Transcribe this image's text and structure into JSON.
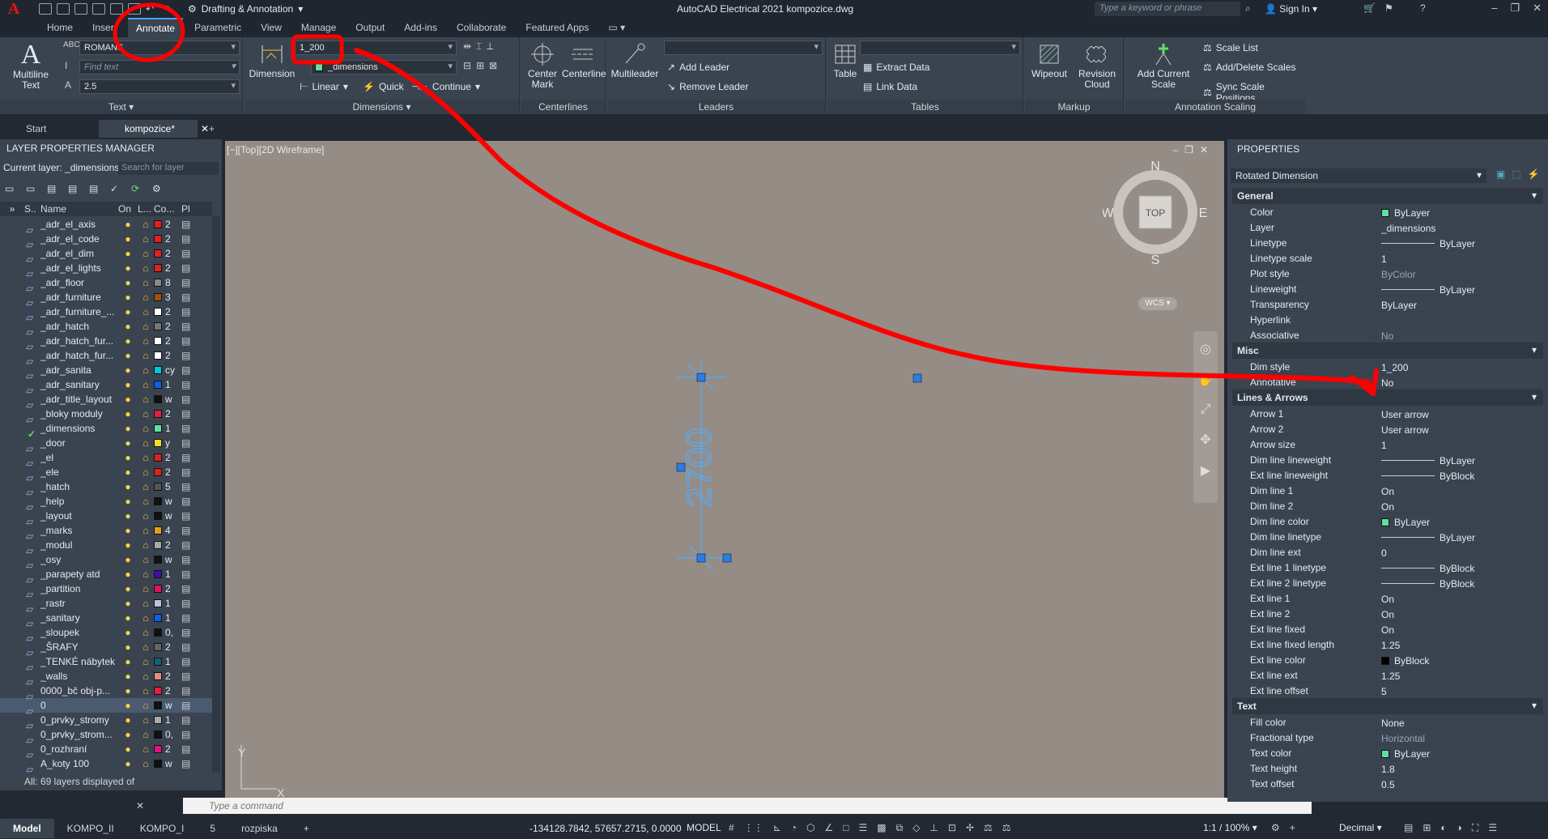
{
  "titlebar": {
    "workspace": "Drafting & Annotation",
    "app_title": "AutoCAD Electrical 2021   kompozice.dwg",
    "search_placeholder": "Type a keyword or phrase",
    "signin": "Sign In"
  },
  "ribbon_tabs": [
    "Home",
    "Insert",
    "Annotate",
    "Parametric",
    "View",
    "Manage",
    "Output",
    "Add-ins",
    "Collaborate",
    "Featured Apps"
  ],
  "ribbon": {
    "text_panel": {
      "title": "Text",
      "multiline": "Multiline Text",
      "font": "ROMANS",
      "find_placeholder": "Find text",
      "height": "2.5"
    },
    "dim_panel": {
      "title": "Dimensions",
      "dimension": "Dimension",
      "style": "1_200",
      "layer": "_dimensions",
      "linear": "Linear",
      "quick": "Quick",
      "continue": "Continue"
    },
    "centerlines": {
      "title": "Centerlines",
      "center_mark": "Center Mark",
      "centerline": "Centerline"
    },
    "leaders": {
      "title": "Leaders",
      "multileader": "Multileader",
      "add_leader": "Add Leader",
      "remove_leader": "Remove Leader"
    },
    "tables": {
      "title": "Tables",
      "table": "Table",
      "extract": "Extract Data",
      "link": "Link Data"
    },
    "markup": {
      "title": "Markup",
      "wipeout": "Wipeout",
      "revision": "Revision Cloud"
    },
    "scaling": {
      "title": "Annotation Scaling",
      "add_scale": "Add Current Scale",
      "scale_list": "Scale List",
      "add_delete": "Add/Delete Scales",
      "sync": "Sync Scale Positions"
    }
  },
  "doc_tabs": [
    "Start",
    "kompozice*"
  ],
  "layer_manager": {
    "title": "LAYER PROPERTIES MANAGER",
    "current": "Current layer: _dimensions",
    "search_placeholder": "Search for layer",
    "columns": [
      "S..",
      "Name",
      "On",
      "L...",
      "Co...",
      "Pl"
    ],
    "status": "All: 69 layers displayed of",
    "rows": [
      {
        "name": "_adr_el_axis",
        "color": "#e02020",
        "cv": "2"
      },
      {
        "name": "_adr_el_code",
        "color": "#e02020",
        "cv": "2"
      },
      {
        "name": "_adr_el_dim",
        "color": "#e02020",
        "cv": "2"
      },
      {
        "name": "_adr_el_lights",
        "color": "#e02020",
        "cv": "2"
      },
      {
        "name": "_adr_floor",
        "color": "#888888",
        "cv": "8"
      },
      {
        "name": "_adr_furniture",
        "color": "#a05010",
        "cv": "3"
      },
      {
        "name": "_adr_furniture_...",
        "color": "#ffffff",
        "cv": "2"
      },
      {
        "name": "_adr_hatch",
        "color": "#777777",
        "cv": "2"
      },
      {
        "name": "_adr_hatch_fur...",
        "color": "#ffffff",
        "cv": "2"
      },
      {
        "name": "_adr_hatch_fur...",
        "color": "#ffffff",
        "cv": "2"
      },
      {
        "name": "_adr_sanita",
        "color": "#00c8e0",
        "cv": "cy"
      },
      {
        "name": "_adr_sanitary",
        "color": "#1060e0",
        "cv": "1"
      },
      {
        "name": "_adr_title_layout",
        "color": "#111111",
        "cv": "w"
      },
      {
        "name": "_bloky moduly",
        "color": "#e02040",
        "cv": "2"
      },
      {
        "name": "_dimensions",
        "color": "#60e0a0",
        "cv": "1",
        "current": true
      },
      {
        "name": "_door",
        "color": "#f0e020",
        "cv": "y"
      },
      {
        "name": "_el",
        "color": "#e02020",
        "cv": "2"
      },
      {
        "name": "_ele",
        "color": "#e02020",
        "cv": "2"
      },
      {
        "name": "_hatch",
        "color": "#555555",
        "cv": "5"
      },
      {
        "name": "_help",
        "color": "#111111",
        "cv": "w"
      },
      {
        "name": "_layout",
        "color": "#111111",
        "cv": "w"
      },
      {
        "name": "_marks",
        "color": "#e0a020",
        "cv": "4"
      },
      {
        "name": "_modul",
        "color": "#aaaaaa",
        "cv": "2"
      },
      {
        "name": "_osy",
        "color": "#111111",
        "cv": "w"
      },
      {
        "name": "_parapety atd",
        "color": "#4010a0",
        "cv": "1"
      },
      {
        "name": "_partition",
        "color": "#e01060",
        "cv": "2"
      },
      {
        "name": "_rastr",
        "color": "#c0c0e0",
        "cv": "1"
      },
      {
        "name": "_sanitary",
        "color": "#1060e0",
        "cv": "1"
      },
      {
        "name": "_sloupek",
        "color": "#111111",
        "cv": "0,"
      },
      {
        "name": "_ŠRAFY",
        "color": "#666666",
        "cv": "2"
      },
      {
        "name": "_TENKÉ nábytek",
        "color": "#106080",
        "cv": "1"
      },
      {
        "name": "_walls",
        "color": "#e09080",
        "cv": "2"
      },
      {
        "name": "0000_bč obj-p...",
        "color": "#e02040",
        "cv": "2"
      },
      {
        "name": "0",
        "color": "#111111",
        "cv": "w",
        "selected": true
      },
      {
        "name": "0_prvky_stromy",
        "color": "#aaaaaa",
        "cv": "1"
      },
      {
        "name": "0_prvky_strom...",
        "color": "#111111",
        "cv": "0,"
      },
      {
        "name": "0_rozhraní",
        "color": "#e01080",
        "cv": "2"
      },
      {
        "name": "A_koty 100",
        "color": "#111111",
        "cv": "w"
      }
    ]
  },
  "viewport": {
    "label": "[−][Top][2D Wireframe]",
    "dim_text": "2700",
    "compass": {
      "n": "N",
      "s": "S",
      "e": "E",
      "w": "W",
      "top": "TOP"
    },
    "wcs": "WCS",
    "y_axis": "Y",
    "x_axis": "X"
  },
  "command_placeholder": "Type a command",
  "properties": {
    "title": "PROPERTIES",
    "selection": "Rotated Dimension",
    "sections": [
      {
        "name": "General",
        "rows": [
          {
            "k": "Color",
            "v": "ByLayer",
            "swatch": "#60e0a0"
          },
          {
            "k": "Layer",
            "v": "_dimensions"
          },
          {
            "k": "Linetype",
            "v": "ByLayer",
            "line": true
          },
          {
            "k": "Linetype scale",
            "v": "1"
          },
          {
            "k": "Plot style",
            "v": "ByColor",
            "gray": true
          },
          {
            "k": "Lineweight",
            "v": "ByLayer",
            "line": true
          },
          {
            "k": "Transparency",
            "v": "ByLayer"
          },
          {
            "k": "Hyperlink",
            "v": ""
          },
          {
            "k": "Associative",
            "v": "No",
            "gray": true
          }
        ]
      },
      {
        "name": "Misc",
        "rows": [
          {
            "k": "Dim style",
            "v": "1_200"
          },
          {
            "k": "Annotative",
            "v": "No"
          }
        ]
      },
      {
        "name": "Lines & Arrows",
        "rows": [
          {
            "k": "Arrow 1",
            "v": "User arrow"
          },
          {
            "k": "Arrow 2",
            "v": "User arrow"
          },
          {
            "k": "Arrow size",
            "v": "1"
          },
          {
            "k": "Dim line lineweight",
            "v": "ByLayer",
            "line": true
          },
          {
            "k": "Ext line lineweight",
            "v": "ByBlock",
            "line": true
          },
          {
            "k": "Dim line 1",
            "v": "On"
          },
          {
            "k": "Dim line 2",
            "v": "On"
          },
          {
            "k": "Dim line color",
            "v": "ByLayer",
            "swatch": "#60e0a0"
          },
          {
            "k": "Dim line linetype",
            "v": "ByLayer",
            "line": true
          },
          {
            "k": "Dim line ext",
            "v": "0"
          },
          {
            "k": "Ext line 1 linetype",
            "v": "ByBlock",
            "line": true
          },
          {
            "k": "Ext line 2 linetype",
            "v": "ByBlock",
            "line": true
          },
          {
            "k": "Ext line 1",
            "v": "On"
          },
          {
            "k": "Ext line 2",
            "v": "On"
          },
          {
            "k": "Ext line fixed",
            "v": "On"
          },
          {
            "k": "Ext line fixed length",
            "v": "1.25"
          },
          {
            "k": "Ext line color",
            "v": "ByBlock",
            "swatch": "#000000"
          },
          {
            "k": "Ext line ext",
            "v": "1.25"
          },
          {
            "k": "Ext line offset",
            "v": "5"
          }
        ]
      },
      {
        "name": "Text",
        "rows": [
          {
            "k": "Fill color",
            "v": "None"
          },
          {
            "k": "Fractional type",
            "v": "Horizontal",
            "gray": true
          },
          {
            "k": "Text color",
            "v": "ByLayer",
            "swatch": "#60e0a0"
          },
          {
            "k": "Text height",
            "v": "1.8"
          },
          {
            "k": "Text offset",
            "v": "0.5"
          }
        ]
      }
    ]
  },
  "status": {
    "layout_tabs": [
      "Model",
      "KOMPO_II",
      "KOMPO_I",
      "5",
      "rozpiska"
    ],
    "coords": "-134128.7842, 57657.2715, 0.0000",
    "model": "MODEL",
    "scale": "1:1 / 100%",
    "units": "Decimal"
  },
  "colors": {
    "accent": "#4aa3ff",
    "annotation_red": "#ff0000",
    "dim_blue": "#5aaaf0",
    "canvas": "#958c85"
  }
}
